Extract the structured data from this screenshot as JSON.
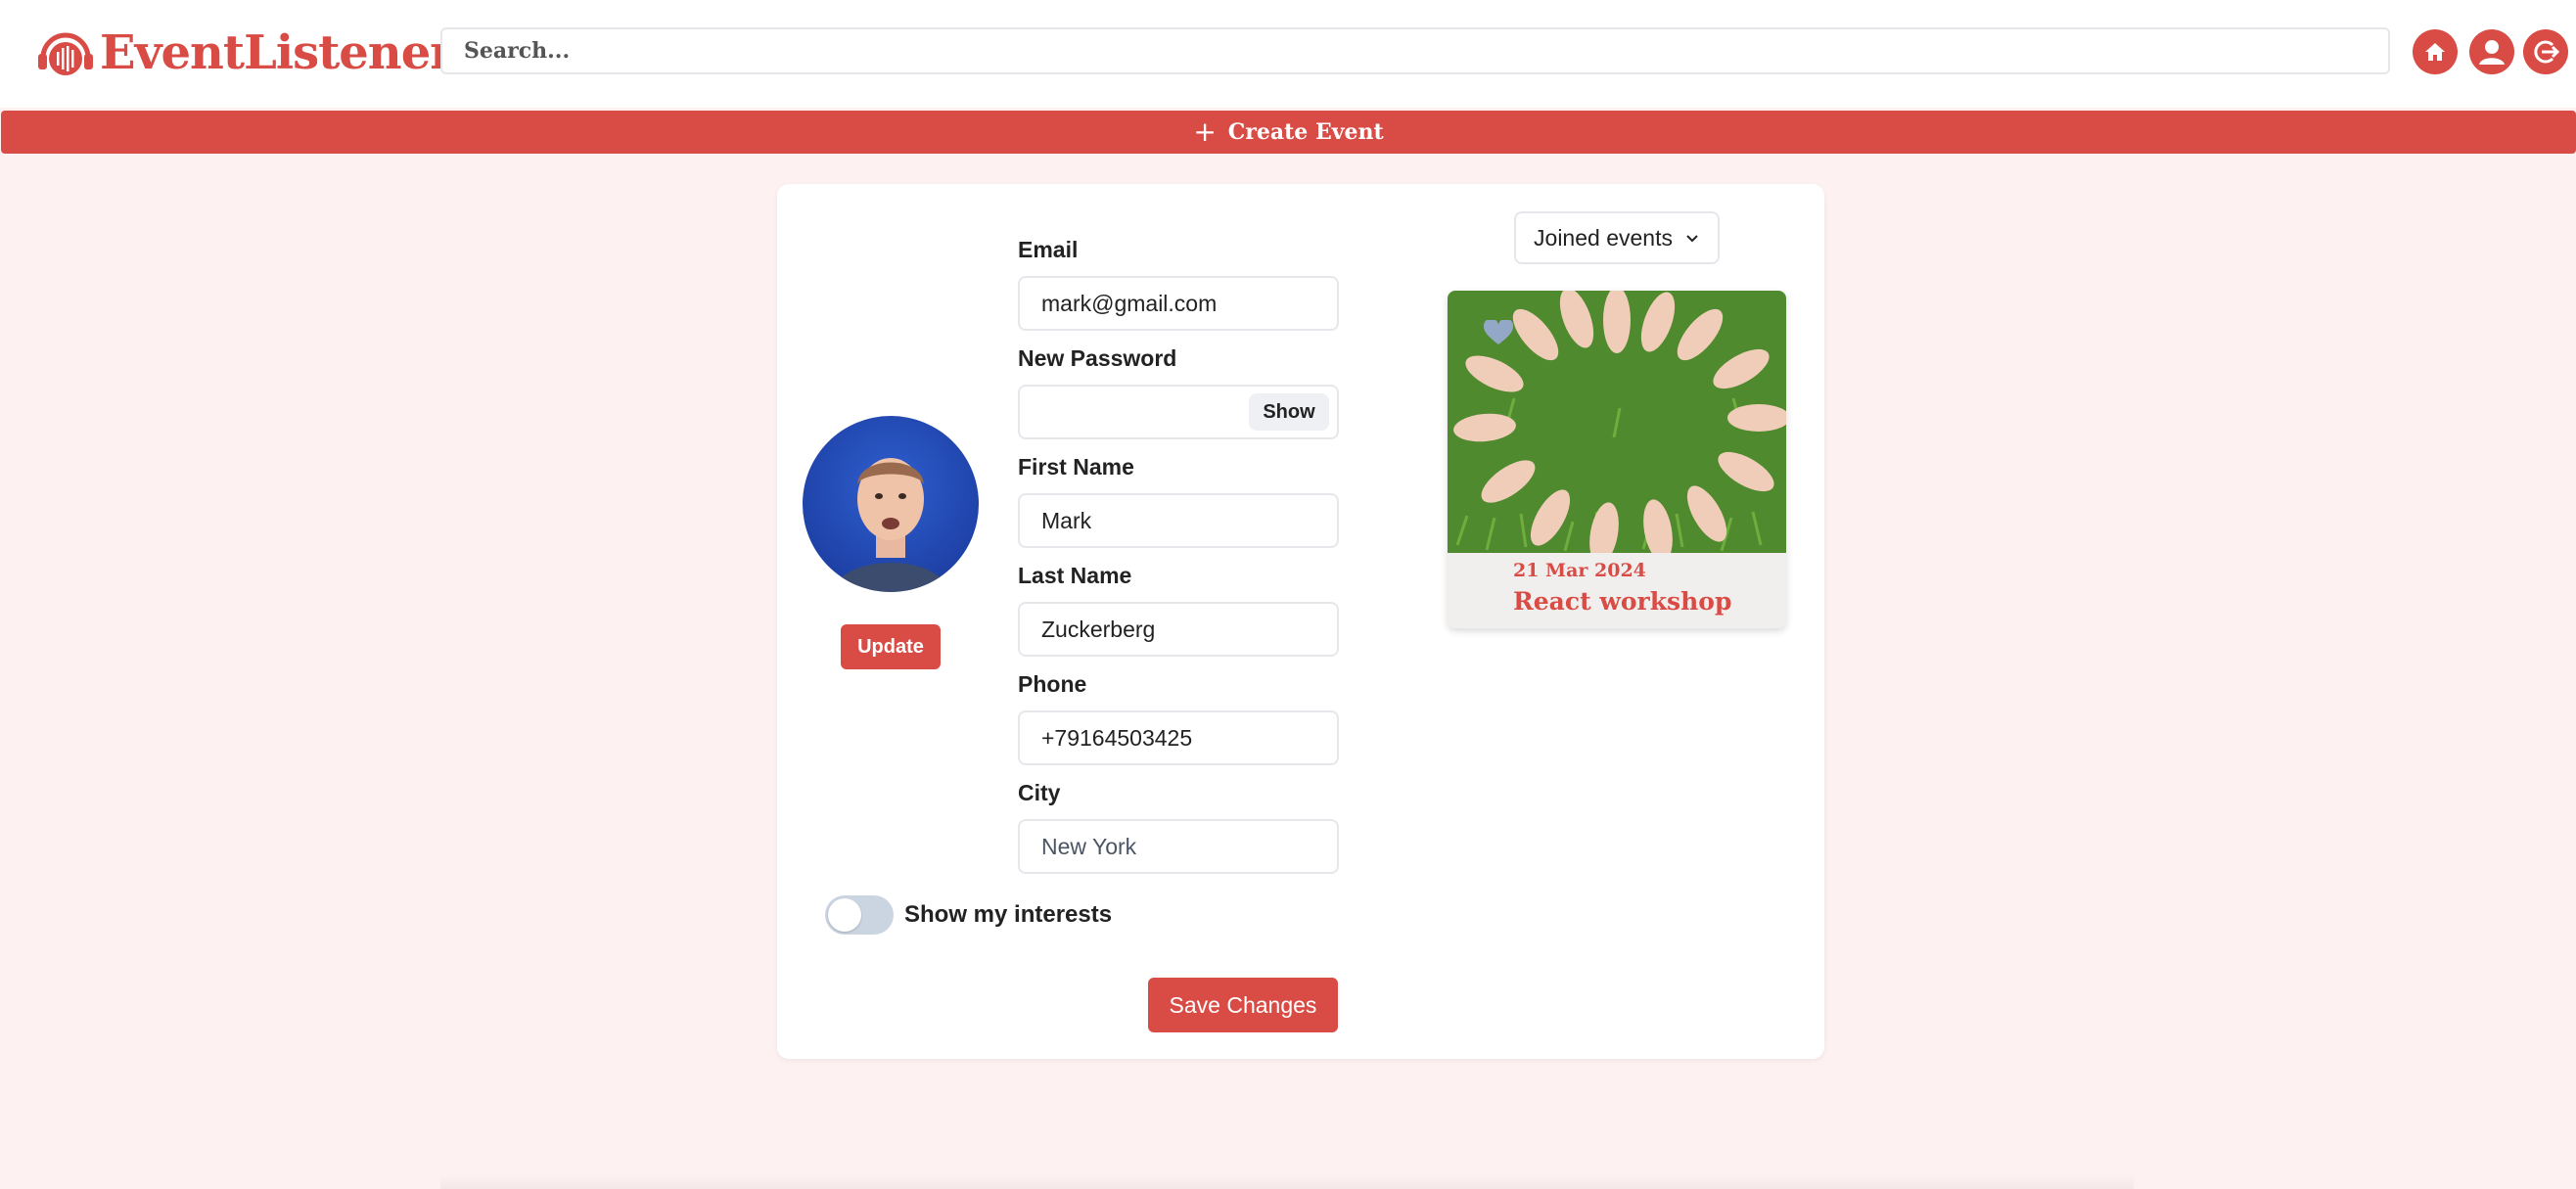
{
  "app": {
    "logo_text": "EventListener"
  },
  "header": {
    "search_placeholder": "Search...",
    "icons": [
      "home-icon",
      "user-icon",
      "logout-icon"
    ]
  },
  "create_event": {
    "label": "Create Event"
  },
  "profile": {
    "update_label": "Update",
    "fields": {
      "email": {
        "label": "Email",
        "value": "mark@gmail.com"
      },
      "password": {
        "label": "New Password",
        "value": "",
        "show_label": "Show"
      },
      "first_name": {
        "label": "First Name",
        "value": "Mark"
      },
      "last_name": {
        "label": "Last Name",
        "value": "Zuckerberg"
      },
      "phone": {
        "label": "Phone",
        "value": "+79164503425"
      },
      "city": {
        "label": "City",
        "value": "",
        "placeholder": "New York"
      }
    },
    "toggle": {
      "label": "Show my interests",
      "on": false
    },
    "save_label": "Save Changes"
  },
  "events_panel": {
    "dropdown_selected": "Joined events",
    "events": [
      {
        "date": "21 Mar 2024",
        "title": "React workshop"
      }
    ]
  },
  "colors": {
    "accent": "#d94b45",
    "background": "#fdf1f1"
  }
}
